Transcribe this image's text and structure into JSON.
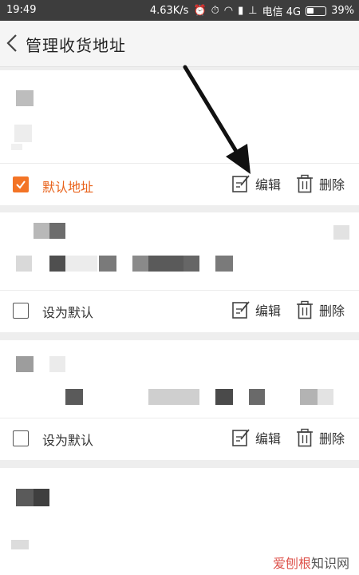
{
  "status_bar": {
    "time": "19:49",
    "speed": "4.63K/s",
    "carrier": "电信 4G",
    "battery": "39%"
  },
  "header": {
    "back_icon": "chevron-left-icon",
    "title": "管理收货地址"
  },
  "addresses": [
    {
      "default": true,
      "checkbox_label": "默认地址",
      "edit_label": "编辑",
      "delete_label": "删除"
    },
    {
      "default": false,
      "checkbox_label": "设为默认",
      "edit_label": "编辑",
      "delete_label": "删除"
    },
    {
      "default": false,
      "checkbox_label": "设为默认",
      "edit_label": "编辑",
      "delete_label": "删除"
    }
  ],
  "colors": {
    "accent": "#f37426",
    "accent_text": "#e8621a",
    "status_bar": "#3d3d3d"
  },
  "watermark": {
    "part1": "爱刨根",
    "part2": "知识网"
  }
}
